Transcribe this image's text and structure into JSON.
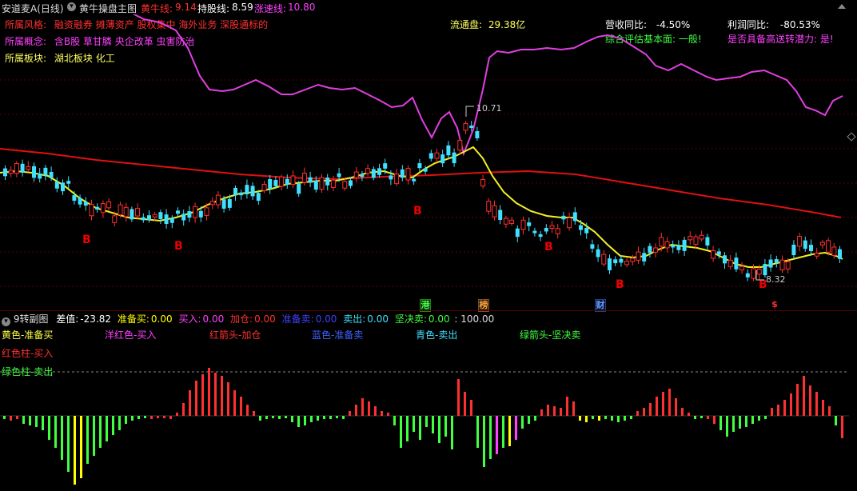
{
  "header": {
    "stock_name": "安道麦A(日线)",
    "main_chart_title": "黄牛操盘主图",
    "indicators": [
      {
        "label": "黄牛线:",
        "value": "9.14",
        "color": "#ff3030"
      },
      {
        "label": "持股线:",
        "value": "8.59",
        "color": "#ffffff"
      },
      {
        "label": "涨速线:",
        "value": "10.80",
        "color": "#ff40ff"
      }
    ]
  },
  "info": {
    "style_label": "所属风格:",
    "style_value": "融资融券 摊薄资产 股权集中 海外业务 深股通标的",
    "concept_label": "所属概念:",
    "concept_value": "含B股 草甘膦 央企改革 虫害防治",
    "sector_label": "所属板块:",
    "sector_value": "湖北板块  化工",
    "float_cap_label": "流通盘:",
    "float_cap_value": "29.38亿",
    "revenue_label": "营收同比:",
    "revenue_value": "-4.50%",
    "profit_label": "利润同比:",
    "profit_value": "-80.53%",
    "eval_label": "综合评估基本面:",
    "eval_value": "一般!",
    "potential_label": "是否具备高送转潜力:",
    "potential_value": "是!"
  },
  "annotations": {
    "high_price": "10.71",
    "low_price": "8.32",
    "buy_marker": "B",
    "event_tags": [
      "港",
      "榜",
      "财",
      "$"
    ]
  },
  "sub_header": {
    "title": "9转副图",
    "items": [
      {
        "label": "差值:",
        "value": "-23.82",
        "color": "#ffffff"
      },
      {
        "label": "准备买:",
        "value": "0.00",
        "color": "#ffff00"
      },
      {
        "label": "买入:",
        "value": "0.00",
        "color": "#ff40ff"
      },
      {
        "label": "加仓:",
        "value": "0.00",
        "color": "#ff3030"
      },
      {
        "label": "准备卖:",
        "value": "0.00",
        "color": "#4040ff"
      },
      {
        "label": "卖出:",
        "value": "0.00",
        "color": "#40e0ff"
      },
      {
        "label": "坚决卖:",
        "value": "0.00",
        "color": "#40ff40"
      }
    ],
    "tail": ": 100.00"
  },
  "legend": [
    {
      "text": "黄色-准备买",
      "color": "#ffff40"
    },
    {
      "text": "洋红色-买入",
      "color": "#ff40ff"
    },
    {
      "text": "红箭头-加仓",
      "color": "#ff3030"
    },
    {
      "text": "蓝色-准备卖",
      "color": "#4060ff"
    },
    {
      "text": "青色-卖出",
      "color": "#40e0ff"
    },
    {
      "text": "绿箭头-坚决卖",
      "color": "#40ff40"
    },
    {
      "text": "红色柱-买入",
      "color": "#ff3030"
    },
    {
      "text": "绿色柱-卖出",
      "color": "#40ff40"
    }
  ]
}
